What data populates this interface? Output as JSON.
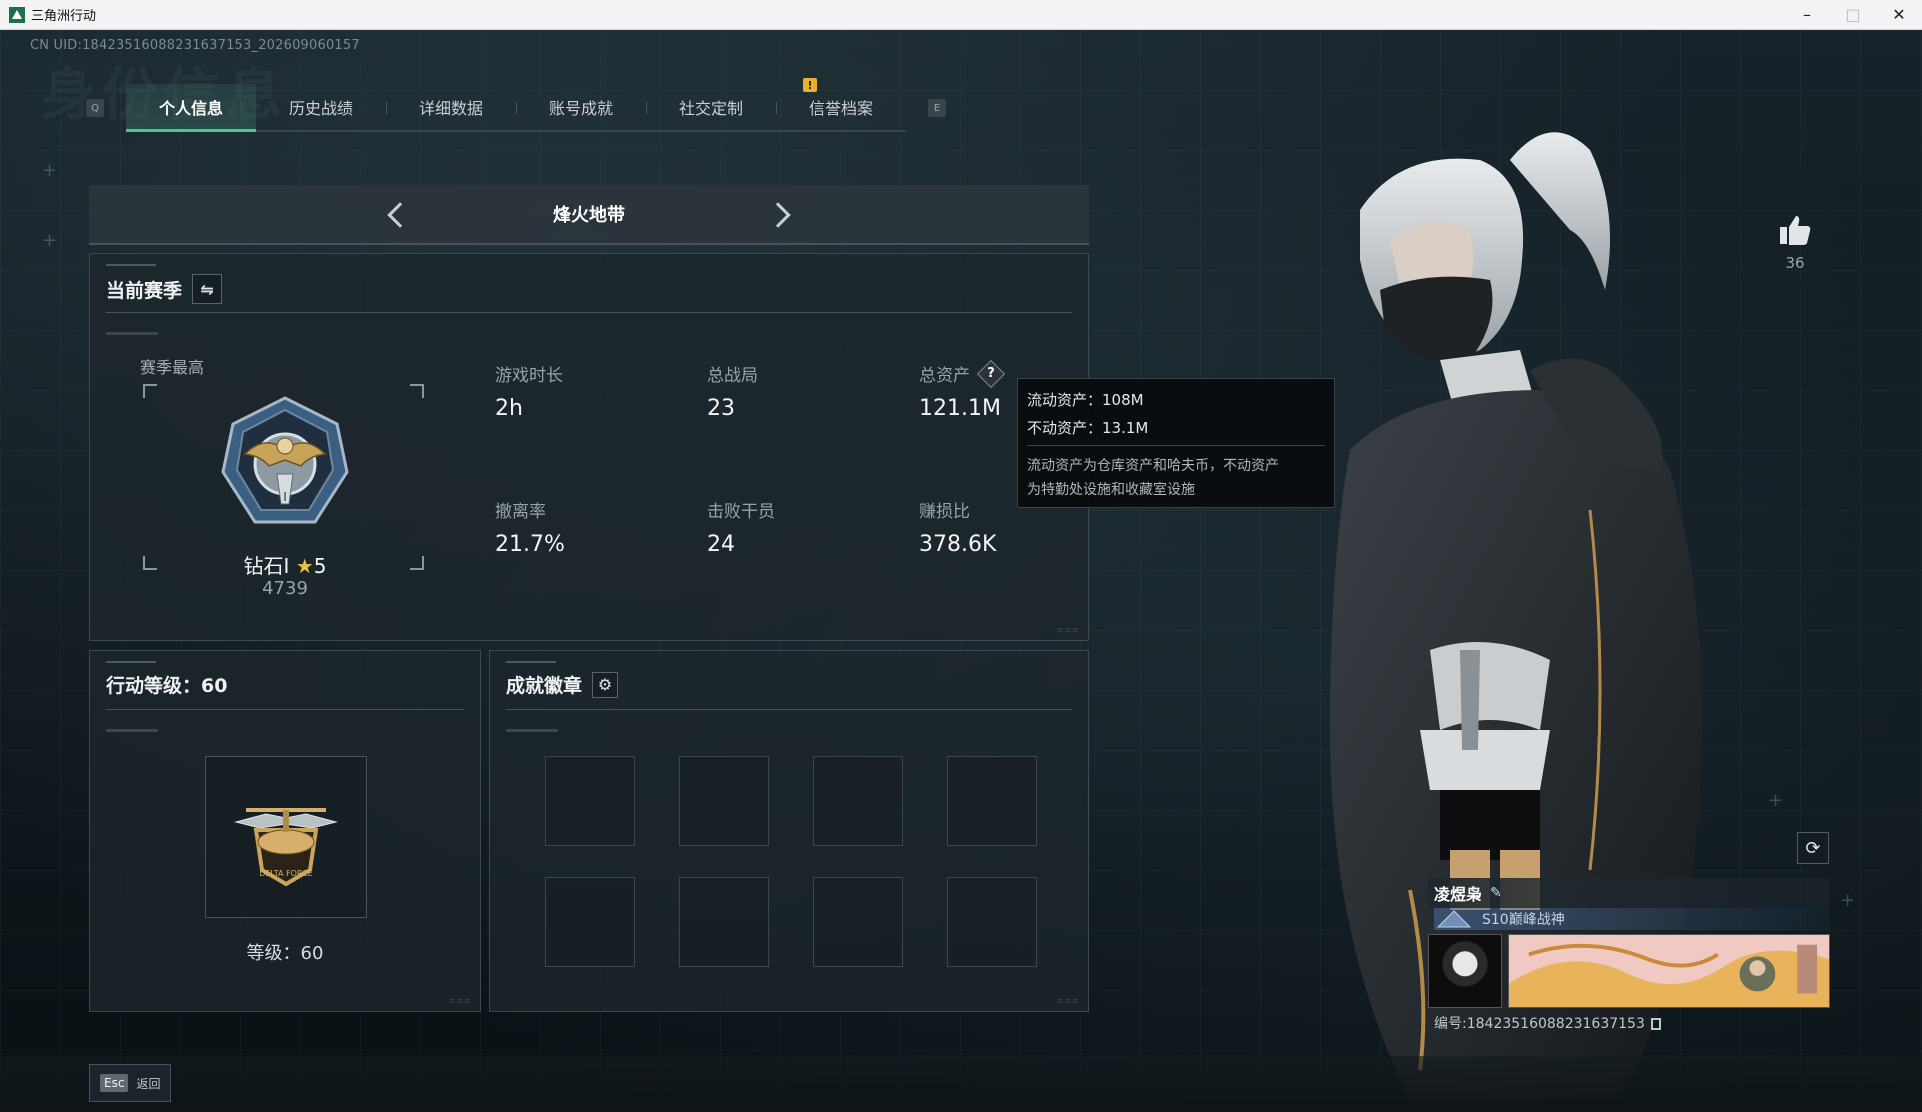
{
  "window": {
    "title": "三角洲行动",
    "controls": {
      "minimize": "–",
      "maximize": "□",
      "close": "✕"
    }
  },
  "header": {
    "uid_text": "CN UID:18423516088231637153_202609060157",
    "watermark": "身份信息"
  },
  "tabs": {
    "prev_key": "Q",
    "next_key": "E",
    "alert": "!",
    "items": [
      {
        "label": "个人信息",
        "active": true
      },
      {
        "label": "历史战绩"
      },
      {
        "label": "详细数据"
      },
      {
        "label": "账号成就"
      },
      {
        "label": "社交定制"
      },
      {
        "label": "信誉档案"
      }
    ]
  },
  "mode": {
    "title": "烽火地带"
  },
  "season": {
    "header": "当前赛季",
    "switch_icon": "swap-icon",
    "best_label": "赛季最高",
    "rank_name": "钻石I",
    "rank_stars": "5",
    "rank_score": "4739",
    "stats": {
      "play_time": {
        "label": "游戏时长",
        "value": "2h"
      },
      "total_matches": {
        "label": "总战局",
        "value": "23"
      },
      "total_assets": {
        "label": "总资产",
        "value": "121.1M"
      },
      "extract_rate": {
        "label": "撤离率",
        "value": "21.7%"
      },
      "kills": {
        "label": "击败干员",
        "value": "24"
      },
      "profit_ratio": {
        "label": "赚损比",
        "value": "378.6K"
      }
    }
  },
  "tooltip": {
    "liquid": "流动资产：108M",
    "fixed": "不动资产：13.1M",
    "desc_line1": "流动资产为仓库资产和哈夫币，不动资产",
    "desc_line2": "为特勤处设施和收藏室设施"
  },
  "level": {
    "header": "行动等级：60",
    "text": "等级：60"
  },
  "badges": {
    "header": "成就徽章",
    "settings_icon": "gear-icon",
    "slots": 8
  },
  "social": {
    "like_count": "36"
  },
  "player": {
    "name": "凌煜枭",
    "title": "S10巅峰战神",
    "id_text": "编号:18423516088231637153"
  },
  "footer": {
    "esc_key": "Esc",
    "esc_label": "返回"
  },
  "colors": {
    "accent": "#45c98f",
    "alert": "#e6b12c",
    "star": "#e6c14a"
  }
}
